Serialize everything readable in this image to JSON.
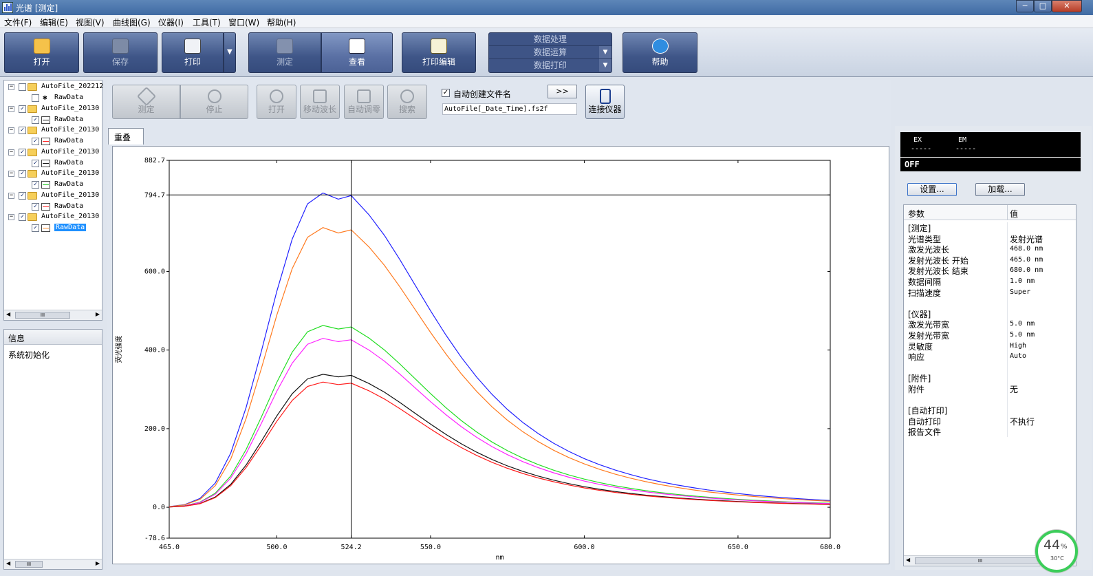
{
  "window": {
    "title": "光谱 [测定]",
    "controls": [
      "─",
      "□",
      "✕"
    ]
  },
  "menu": [
    "文件(F)",
    "编辑(E)",
    "视图(V)",
    "曲线图(G)",
    "仪器(I)",
    "工具(T)",
    "窗口(W)",
    "帮助(H)"
  ],
  "ribbon": {
    "open": "打开",
    "save": "保存",
    "print": "打印",
    "dropdown": "▼",
    "measure": "测定",
    "view": "查看",
    "print_edit": "打印编辑",
    "data_processing": {
      "title": "数据处理",
      "calc": "数据运算",
      "print": "数据打印",
      "arrow": "▼"
    },
    "help": "帮助"
  },
  "tree": {
    "items": [
      {
        "label": "AutoFile_202212",
        "child": "RawData",
        "checked": false,
        "child_checked": false,
        "legend_color": null
      },
      {
        "label": "AutoFile_20130",
        "child": "RawData",
        "checked": true,
        "child_checked": true,
        "legend_color": "#1a1a1a"
      },
      {
        "label": "AutoFile_20130",
        "child": "RawData",
        "checked": true,
        "child_checked": true,
        "legend_color": "#ff2a2a"
      },
      {
        "label": "AutoFile_20130",
        "child": "RawData",
        "checked": true,
        "child_checked": true,
        "legend_color": "#1a1a1a"
      },
      {
        "label": "AutoFile_20130",
        "child": "RawData",
        "checked": true,
        "child_checked": true,
        "legend_color": "#22cc22"
      },
      {
        "label": "AutoFile_20130",
        "child": "RawData",
        "checked": true,
        "child_checked": true,
        "legend_color": "#ff2a2a"
      },
      {
        "label": "AutoFile_20130",
        "child": "RawData",
        "checked": true,
        "child_checked": true,
        "legend_color": "#ff8a2a",
        "selected": true
      }
    ],
    "scroll_thumb": "III",
    "left_arrow": "◀",
    "right_arrow": "▶"
  },
  "info": {
    "header": "信息",
    "message": "系统初始化"
  },
  "toolbar": {
    "measure": "测定",
    "stop": "停止",
    "open": "打开",
    "move_wavelength": "移动波长",
    "auto_zero": "自动调零",
    "search": "搜索",
    "auto_filename_label": "自动创建文件名",
    "auto_filename_checked": true,
    "filename": "AutoFile[_Date_Time].fs2f",
    "arrow_btn": ">>",
    "connect": "连接仪器"
  },
  "tab": "重叠",
  "chart_data": {
    "type": "line",
    "title": "",
    "xlabel": "nm",
    "ylabel": "荧光强度",
    "xlim": [
      465.0,
      680.0
    ],
    "ylim": [
      -78.6,
      882.7
    ],
    "x_ticks": [
      "465.0",
      "500.0",
      "524.2",
      "550.0",
      "600.0",
      "650.0",
      "680.0"
    ],
    "y_ticks": [
      "882.7",
      "794.7",
      "600.0",
      "400.0",
      "200.0",
      "0.0",
      "-78.6"
    ],
    "cursor": {
      "x": 524.2,
      "y": 794.7
    },
    "x": [
      465,
      470,
      475,
      480,
      485,
      490,
      495,
      500,
      505,
      510,
      515,
      520,
      524.2,
      530,
      535,
      540,
      545,
      550,
      555,
      560,
      565,
      570,
      575,
      580,
      585,
      590,
      595,
      600,
      605,
      610,
      615,
      620,
      625,
      630,
      635,
      640,
      645,
      650,
      655,
      660,
      665,
      670,
      675,
      680
    ],
    "series": [
      {
        "color": "#2020ff",
        "values": [
          1.6,
          6.7,
          22.5,
          61.6,
          137.6,
          253.3,
          397.7,
          549.3,
          682.3,
          771.8,
          799.7,
          784.0,
          793.1,
          744.1,
          691.6,
          630.4,
          565.0,
          499.9,
          438.1,
          381.5,
          331.2,
          287.1,
          248.9,
          216.0,
          187.6,
          163.1,
          142.0,
          123.9,
          108.3,
          94.9,
          83.2,
          73.1,
          64.4,
          56.9,
          50.2,
          44.4,
          39.3,
          34.8,
          30.9,
          27.4,
          24.4,
          21.7,
          19.3,
          17.2
        ]
      },
      {
        "color": "#ff7a1f",
        "values": [
          1.4,
          6.0,
          20.0,
          54.8,
          122.4,
          225.4,
          353.9,
          488.9,
          607.2,
          686.9,
          711.7,
          697.8,
          705.9,
          662.2,
          615.5,
          561.1,
          502.9,
          444.9,
          389.9,
          339.5,
          294.8,
          255.5,
          221.5,
          192.2,
          167.0,
          145.2,
          126.4,
          110.3,
          96.4,
          84.5,
          74.1,
          65.1,
          57.3,
          50.6,
          44.7,
          39.5,
          35.0,
          31.0,
          27.5,
          24.4,
          21.7,
          19.3,
          17.2,
          15.3
        ]
      },
      {
        "color": "#22dd22",
        "values": [
          0.9,
          3.9,
          13.0,
          35.7,
          79.6,
          146.5,
          230.1,
          317.8,
          394.7,
          446.5,
          462.6,
          453.6,
          458.8,
          430.4,
          400.1,
          364.7,
          326.9,
          289.2,
          253.4,
          220.7,
          191.6,
          166.1,
          144.0,
          125.0,
          108.5,
          94.4,
          82.2,
          71.7,
          62.7,
          54.9,
          48.2,
          42.3,
          37.2,
          32.9,
          29.1,
          25.7,
          22.7,
          20.1,
          17.9,
          15.9,
          14.1,
          12.6,
          11.2,
          10.0
        ]
      },
      {
        "color": "#ff22ff",
        "values": [
          0.8,
          3.6,
          12.1,
          33.1,
          74.0,
          136.1,
          213.8,
          295.3,
          366.7,
          414.9,
          429.8,
          421.4,
          426.3,
          399.9,
          371.8,
          338.8,
          303.7,
          268.7,
          235.5,
          205.1,
          178.0,
          154.3,
          133.8,
          116.1,
          100.8,
          87.7,
          76.3,
          66.6,
          58.2,
          51.0,
          44.7,
          39.3,
          34.6,
          30.6,
          27.0,
          23.9,
          21.1,
          18.7,
          16.6,
          14.7,
          13.1,
          11.7,
          10.4,
          9.3
        ]
      },
      {
        "color": "#111111",
        "values": [
          0.7,
          2.9,
          9.5,
          26.1,
          58.2,
          107.2,
          168.3,
          232.4,
          288.7,
          326.6,
          338.4,
          331.8,
          335.6,
          314.9,
          292.7,
          266.8,
          239.1,
          211.5,
          185.4,
          161.4,
          140.1,
          121.5,
          105.3,
          91.4,
          79.4,
          69.0,
          60.1,
          52.4,
          45.8,
          40.2,
          35.2,
          30.9,
          27.3,
          24.1,
          21.2,
          18.8,
          16.6,
          14.7,
          13.1,
          11.6,
          10.3,
          9.2,
          8.2,
          7.3
        ]
      },
      {
        "color": "#ff1a1a",
        "values": [
          0.6,
          2.7,
          9.0,
          24.5,
          54.8,
          100.9,
          158.4,
          218.8,
          271.7,
          307.4,
          318.5,
          312.2,
          315.8,
          296.3,
          275.5,
          251.1,
          225.0,
          199.1,
          174.5,
          151.9,
          131.9,
          114.3,
          99.1,
          86.0,
          74.7,
          65.0,
          56.6,
          49.3,
          43.1,
          37.8,
          33.1,
          29.1,
          25.7,
          22.7,
          20.0,
          17.7,
          15.6,
          13.9,
          12.3,
          10.9,
          9.7,
          8.6,
          7.7,
          6.8
        ]
      }
    ]
  },
  "display": {
    "ex": "EX",
    "em": "EM",
    "ex_val": "-----",
    "em_val": "-----",
    "status": "OFF"
  },
  "settings_btn": "设置...",
  "load_btn": "加载...",
  "params": {
    "col_param": "参数",
    "col_value": "值",
    "rows": [
      {
        "k": "[测定]",
        "v": ""
      },
      {
        "k": "光谱类型",
        "v": "发射光谱"
      },
      {
        "k": "激发光波长",
        "v": "468.0 nm",
        "mono": true
      },
      {
        "k": "发射光波长 开始",
        "v": "465.0 nm",
        "mono": true
      },
      {
        "k": "发射光波长 结束",
        "v": "680.0 nm",
        "mono": true
      },
      {
        "k": "数据间隔",
        "v": "1.0 nm",
        "mono": true
      },
      {
        "k": "扫描速度",
        "v": "Super",
        "mono": true
      },
      {
        "k": "",
        "v": ""
      },
      {
        "k": "[仪器]",
        "v": ""
      },
      {
        "k": "激发光带宽",
        "v": "5.0 nm",
        "mono": true
      },
      {
        "k": "发射光带宽",
        "v": "5.0 nm",
        "mono": true
      },
      {
        "k": "灵敏度",
        "v": "High",
        "mono": true
      },
      {
        "k": "响应",
        "v": "Auto",
        "mono": true
      },
      {
        "k": "",
        "v": ""
      },
      {
        "k": "[附件]",
        "v": ""
      },
      {
        "k": "附件",
        "v": "无"
      },
      {
        "k": "",
        "v": ""
      },
      {
        "k": "[自动打印]",
        "v": ""
      },
      {
        "k": "自动打印",
        "v": "不执行"
      },
      {
        "k": "报告文件",
        "v": ""
      }
    ]
  },
  "gauge": {
    "percent": "44",
    "unit": "%",
    "temp": "30°C"
  }
}
